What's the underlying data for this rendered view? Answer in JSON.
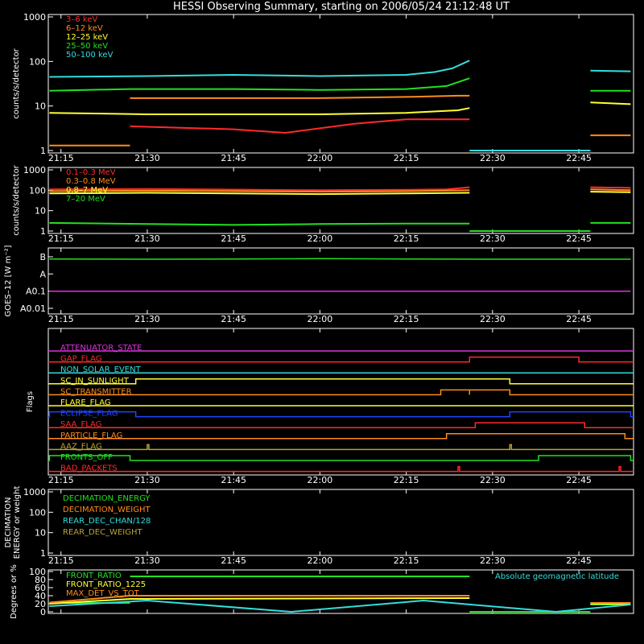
{
  "title": "HESSI Observing Summary, starting on 2006/05/24 21:12:48 UT",
  "time_ticks": [
    "21:15",
    "21:30",
    "21:45",
    "22:00",
    "22:15",
    "22:30",
    "22:45"
  ],
  "colors": {
    "red": "#ff2a2a",
    "orange": "#ff8c1a",
    "yellow": "#ffff33",
    "green": "#22e022",
    "cyan": "#33dddd",
    "magenta": "#dd33dd",
    "blue": "#2244ff",
    "olive": "#b8a23a",
    "white": "#ffffff"
  },
  "chart_data": [
    {
      "type": "line",
      "ylabel": "counts/s/detector",
      "scale": "log",
      "ylim": [
        1,
        1000
      ],
      "yticks": [
        "1",
        "10",
        "100",
        "1000"
      ],
      "legend_position": "top-left",
      "series": [
        {
          "name": "3–6 keV",
          "color": "red",
          "segments": [
            {
              "x": [
                "21:27",
                "21:45",
                "21:54",
                "22:06",
                "22:15",
                "22:24",
                "22:26"
              ],
              "y": [
                3.5,
                3,
                2.5,
                4,
                5,
                5,
                5
              ]
            }
          ]
        },
        {
          "name": "6–12 keV",
          "color": "orange",
          "segments": [
            {
              "x": [
                "21:13",
                "21:27"
              ],
              "y": [
                1.3,
                1.3
              ]
            },
            {
              "x": [
                "21:27",
                "21:45",
                "22:00",
                "22:15",
                "22:24",
                "22:26"
              ],
              "y": [
                15,
                15,
                15,
                16,
                17,
                17
              ]
            },
            {
              "x": [
                "22:47",
                "22:54"
              ],
              "y": [
                2.2,
                2.2
              ]
            }
          ]
        },
        {
          "name": "12–25 keV",
          "color": "yellow",
          "segments": [
            {
              "x": [
                "21:13",
                "21:30",
                "21:45",
                "22:00",
                "22:15",
                "22:24",
                "22:26"
              ],
              "y": [
                7,
                6.5,
                6.5,
                6.5,
                7,
                8,
                9
              ]
            },
            {
              "x": [
                "22:47",
                "22:54"
              ],
              "y": [
                12,
                11
              ]
            }
          ]
        },
        {
          "name": "25–50 keV",
          "color": "green",
          "segments": [
            {
              "x": [
                "21:13",
                "21:27",
                "21:45",
                "22:00",
                "22:15",
                "22:22",
                "22:26"
              ],
              "y": [
                22,
                24,
                24,
                23,
                24,
                28,
                42
              ]
            },
            {
              "x": [
                "22:47",
                "22:54"
              ],
              "y": [
                22,
                22
              ]
            }
          ]
        },
        {
          "name": "50–100 keV",
          "color": "cyan",
          "segments": [
            {
              "x": [
                "21:13",
                "21:30",
                "21:45",
                "22:00",
                "22:15",
                "22:20",
                "22:23",
                "22:26"
              ],
              "y": [
                45,
                47,
                50,
                47,
                50,
                58,
                70,
                105
              ]
            },
            {
              "x": [
                "22:26",
                "22:47"
              ],
              "y": [
                1,
                1
              ]
            },
            {
              "x": [
                "22:47",
                "22:54"
              ],
              "y": [
                62,
                60
              ]
            }
          ]
        }
      ]
    },
    {
      "type": "line",
      "ylabel": "counts/s/detector",
      "scale": "log",
      "ylim": [
        1,
        1000
      ],
      "yticks": [
        "1",
        "10",
        "100",
        "1000"
      ],
      "legend_position": "top-left",
      "series": [
        {
          "name": "0.1–0.3 MeV",
          "color": "red",
          "segments": [
            {
              "x": [
                "21:13",
                "21:30",
                "22:00",
                "22:15",
                "22:22",
                "22:26"
              ],
              "y": [
                110,
                115,
                100,
                105,
                110,
                140
              ]
            },
            {
              "x": [
                "22:47",
                "22:54"
              ],
              "y": [
                140,
                130
              ]
            }
          ]
        },
        {
          "name": "0.3–0.8 MeV",
          "color": "orange",
          "segments": [
            {
              "x": [
                "21:13",
                "21:30",
                "22:00",
                "22:15",
                "22:26"
              ],
              "y": [
                90,
                95,
                85,
                90,
                100
              ]
            },
            {
              "x": [
                "22:47",
                "22:54"
              ],
              "y": [
                110,
                100
              ]
            }
          ]
        },
        {
          "name": "0.8–7 MeV",
          "color": "yellow",
          "segments": [
            {
              "x": [
                "21:13",
                "21:30",
                "22:00",
                "22:15",
                "22:26"
              ],
              "y": [
                70,
                75,
                65,
                70,
                75
              ]
            },
            {
              "x": [
                "22:47",
                "22:54"
              ],
              "y": [
                85,
                80
              ]
            }
          ]
        },
        {
          "name": "7–20 MeV",
          "color": "green",
          "segments": [
            {
              "x": [
                "21:13",
                "21:30",
                "21:45",
                "22:00",
                "22:15",
                "22:26"
              ],
              "y": [
                2.5,
                2.2,
                2,
                2.2,
                2.3,
                2.3
              ]
            },
            {
              "x": [
                "22:26",
                "22:47"
              ],
              "y": [
                1,
                1
              ]
            },
            {
              "x": [
                "22:47",
                "22:54"
              ],
              "y": [
                2.5,
                2.5
              ]
            }
          ]
        }
      ]
    },
    {
      "type": "line",
      "ylabel": "GOES–12 [W m⁻²]",
      "scale": "log",
      "yticks": [
        "A0.01",
        "A0.1",
        "A",
        "B"
      ],
      "series": [
        {
          "name": "GOES long",
          "color": "green",
          "segments": [
            {
              "x": [
                "21:13",
                "21:30",
                "21:45",
                "22:00",
                "22:15",
                "22:30",
                "22:45",
                "22:54"
              ],
              "y": [
                "0.75B",
                "0.72B",
                "0.74B",
                "0.78B",
                "0.75B",
                "0.72B",
                "0.72B",
                "0.72B"
              ]
            }
          ]
        },
        {
          "name": "GOES short",
          "color": "magenta",
          "segments": [
            {
              "x": [
                "21:13",
                "22:54"
              ],
              "y": [
                "A0.1",
                "A0.1"
              ]
            }
          ]
        }
      ]
    },
    {
      "type": "step",
      "ylabel": "Flags",
      "flags": [
        {
          "name": "ATTENUATOR_STATE",
          "color": "magenta",
          "high": []
        },
        {
          "name": "GAP_FLAG",
          "color": "red",
          "high": [
            [
              "22:26",
              "22:45"
            ]
          ]
        },
        {
          "name": "NON_SOLAR_EVENT",
          "color": "cyan",
          "high": []
        },
        {
          "name": "SC_IN_SUNLIGHT",
          "color": "yellow",
          "high": [
            [
              "21:28",
              "22:33"
            ]
          ]
        },
        {
          "name": "SC_TRANSMITTER",
          "color": "orange",
          "high": [
            [
              "22:21",
              "22:26"
            ],
            [
              "22:26",
              "22:33"
            ]
          ]
        },
        {
          "name": "FLARE_FLAG",
          "color": "yellow",
          "high": []
        },
        {
          "name": "ECLIPSE_FLAG",
          "color": "blue",
          "high": [
            [
              "21:13",
              "21:28"
            ],
            [
              "22:33",
              "22:54"
            ]
          ]
        },
        {
          "name": "SAA_FLAG",
          "color": "red",
          "high": [
            [
              "22:27",
              "22:46"
            ]
          ]
        },
        {
          "name": "PARTICLE_FLAG",
          "color": "orange",
          "high": [
            [
              "22:22",
              "22:53"
            ]
          ]
        },
        {
          "name": "AAZ_FLAG",
          "color": "olive",
          "high": [
            [
              "21:30",
              "21:30"
            ],
            [
              "22:33",
              "22:33"
            ]
          ]
        },
        {
          "name": "FRONTS_OFF",
          "color": "green",
          "high": [
            [
              "21:13",
              "21:27"
            ],
            [
              "22:38",
              "22:54"
            ]
          ]
        },
        {
          "name": "BAD_PACKETS",
          "color": "red",
          "high": [
            [
              "22:24",
              "22:24"
            ],
            [
              "22:52",
              "22:52"
            ]
          ]
        }
      ]
    },
    {
      "type": "line",
      "ylabel": "DECIMATION ENERGY or weight",
      "scale": "log",
      "ylim": [
        1,
        1000
      ],
      "yticks": [
        "1",
        "10",
        "100",
        "1000"
      ],
      "legend_position": "top-left",
      "series": [
        {
          "name": "DECIMATION_ENERGY",
          "color": "green",
          "segments": []
        },
        {
          "name": "DECIMATION_WEIGHT",
          "color": "orange",
          "segments": []
        },
        {
          "name": "REAR_DEC_CHAN/128",
          "color": "cyan",
          "segments": []
        },
        {
          "name": "REAR_DEC_WEIGHT",
          "color": "olive",
          "segments": []
        }
      ]
    },
    {
      "type": "line",
      "ylabel": "Degrees or %",
      "scale": "linear",
      "ylim": [
        0,
        100
      ],
      "yticks": [
        "0",
        "20",
        "40",
        "60",
        "80",
        "100"
      ],
      "legend_position": "top-left",
      "annotation": "Absolute geomagnetic latitude",
      "series": [
        {
          "name": "FRONT_RATIO",
          "color": "green",
          "segments": [
            {
              "x": [
                "21:13",
                "21:27"
              ],
              "y": [
                22,
                22
              ]
            },
            {
              "x": [
                "21:27",
                "22:26"
              ],
              "y": [
                88,
                88
              ]
            },
            {
              "x": [
                "22:26",
                "22:47"
              ],
              "y": [
                0,
                0
              ]
            },
            {
              "x": [
                "22:47",
                "22:54"
              ],
              "y": [
                18,
                18
              ]
            }
          ]
        },
        {
          "name": "FRONT_RATIO_1225",
          "color": "yellow",
          "segments": [
            {
              "x": [
                "21:13",
                "21:27",
                "22:26"
              ],
              "y": [
                20,
                32,
                34
              ]
            },
            {
              "x": [
                "22:47",
                "22:54"
              ],
              "y": [
                20,
                20
              ]
            }
          ]
        },
        {
          "name": "MAX_DET_VS_TOT",
          "color": "orange",
          "segments": [
            {
              "x": [
                "21:13",
                "21:27",
                "22:26"
              ],
              "y": [
                23,
                40,
                40
              ]
            },
            {
              "x": [
                "22:47",
                "22:54"
              ],
              "y": [
                22,
                22
              ]
            }
          ]
        },
        {
          "name": "Absolute geomagnetic latitude",
          "color": "cyan",
          "segments": [
            {
              "x": [
                "21:13",
                "21:30",
                "21:55",
                "22:18",
                "22:41",
                "22:54"
              ],
              "y": [
                14,
                28,
                0,
                28,
                0,
                18
              ]
            }
          ]
        }
      ]
    }
  ]
}
